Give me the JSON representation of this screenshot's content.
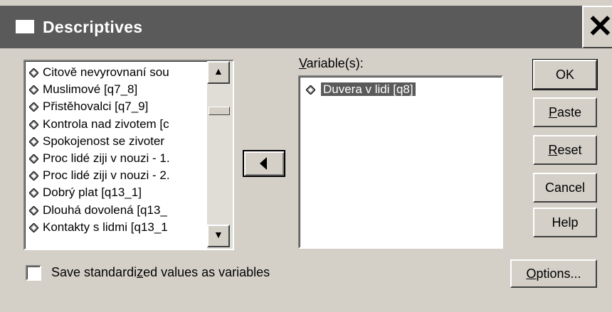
{
  "window": {
    "title": "Descriptives",
    "close_glyph": "✕"
  },
  "source_list": {
    "items": [
      "Citově nevyrovnaní sou",
      "Muslimové [q7_8]",
      "Přistěhovalci [q7_9]",
      "Kontrola nad zivotem [c",
      "Spokojenost se zivoter",
      "Proc lidé ziji v nouzi - 1.",
      "Proc lidé ziji v nouzi - 2.",
      "Dobrý plat [q13_1]",
      "Dlouhá dovolená [q13_",
      "Kontakty s lidmi  [q13_1"
    ],
    "item_icon": "scale-variable-icon"
  },
  "move_button": {
    "icon": "left-arrow-icon"
  },
  "variables": {
    "label_underlined": "V",
    "label_rest": "ariable(s):",
    "items": [
      "Duvera v lidi [q8]"
    ]
  },
  "buttons": {
    "ok": {
      "pre": "OK",
      "u": "",
      "post": ""
    },
    "paste": {
      "pre": "",
      "u": "P",
      "post": "aste"
    },
    "reset": {
      "pre": "",
      "u": "R",
      "post": "eset"
    },
    "cancel": {
      "pre": "Cancel",
      "u": "",
      "post": ""
    },
    "help": {
      "pre": "Help",
      "u": "",
      "post": ""
    },
    "options": {
      "pre": "",
      "u": "O",
      "post": "ptions..."
    }
  },
  "save_checkbox": {
    "checked": false,
    "label_pre": "Save standardi",
    "label_u": "z",
    "label_post": "ed values as variables"
  }
}
